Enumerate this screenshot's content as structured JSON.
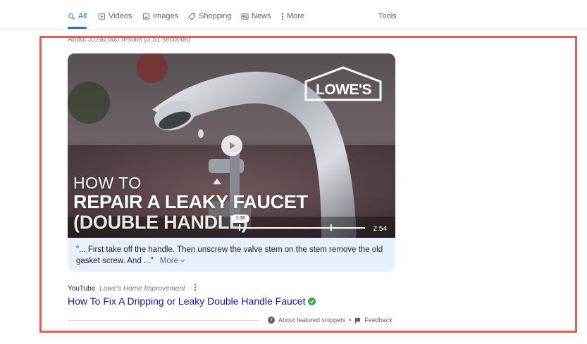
{
  "tabs": [
    {
      "label": "All",
      "icon": "search-icon",
      "active": true
    },
    {
      "label": "Videos",
      "icon": "video-icon"
    },
    {
      "label": "Images",
      "icon": "image-icon"
    },
    {
      "label": "Shopping",
      "icon": "tag-icon"
    },
    {
      "label": "News",
      "icon": "news-icon"
    },
    {
      "label": "More",
      "icon": "more-vert-icon"
    }
  ],
  "tools_label": "Tools",
  "result_stats": "About 3,090,000 results (0.51 seconds)",
  "video": {
    "brand_logo": "LOWE'S",
    "title_lines": [
      "HOW TO",
      "REPAIR A LEAKY FAUCET",
      "(DOUBLE HANDLE)"
    ],
    "current_time": "1:38",
    "duration": "2:54",
    "progress_fraction": 0.563
  },
  "snippet": {
    "quote": "\"... First take off the handle. Then unscrew the valve stem on the stem remove the old gasket screw. And ...\"",
    "more_label": "More"
  },
  "source": {
    "site": "YouTube",
    "channel": "Lowe's Home Improvement"
  },
  "result_title": "How To Fix A Dripping or Leaky Double Handle Faucet",
  "footer": {
    "about_label": "About featured snippets",
    "separator": "•",
    "feedback_label": "Feedback"
  },
  "colors": {
    "accent": "#1a73e8",
    "link": "#1a0dab",
    "highlight_border": "#ea5a4f",
    "snippet_bg": "#e8f0fe",
    "verified": "#34a853"
  }
}
